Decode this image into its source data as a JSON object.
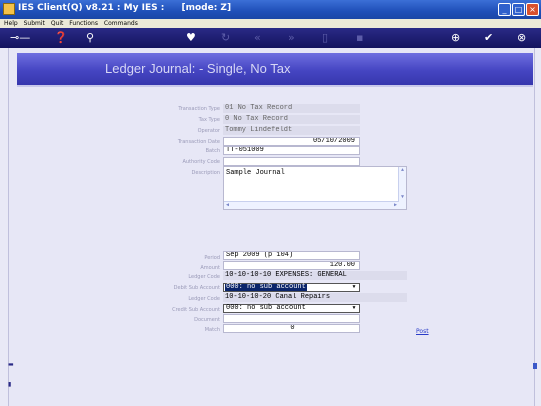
{
  "window": {
    "title": "IES Client(Q) v8.21 : My IES :",
    "mode": "[mode: Z]"
  },
  "menu": [
    "Help",
    "Submit",
    "Quit",
    "Functions",
    "Commands"
  ],
  "toolbar_icons": [
    "key-icon",
    "help-icon",
    "search-icon",
    "heart-icon",
    "refresh-icon",
    "back-icon",
    "forward-icon",
    "list-icon",
    "delete-icon",
    "add-icon",
    "check-icon",
    "close-icon"
  ],
  "banner": {
    "title": "Ledger Journal: -    Single, No Tax"
  },
  "form": {
    "transaction_type": {
      "label": "Transaction Type",
      "value": "01 No Tax Record"
    },
    "tax_type": {
      "label": "Tax Type",
      "value": "0 No Tax Record"
    },
    "operator": {
      "label": "Operator",
      "value": "Tommy Lindefeldt"
    },
    "transaction_date": {
      "label": "Transaction Date",
      "value": "05/10/2009"
    },
    "batch": {
      "label": "Batch",
      "value": "TT-051009"
    },
    "authority_code": {
      "label": "Authority Code",
      "value": ""
    },
    "description": {
      "label": "Description",
      "value": "Sample Journal"
    },
    "period": {
      "label": "Period",
      "value": "Sep 2009 (p 104)"
    },
    "amount": {
      "label": "Amount",
      "value": "120.00"
    },
    "debit_ledger_code": {
      "label": "Ledger Code",
      "value": "10-10-10-10 EXPENSES: GENERAL"
    },
    "debit_sub_account": {
      "label": "Debit Sub Account",
      "value": "000: no sub account"
    },
    "credit_ledger_code": {
      "label": "Ledger Code",
      "value": "10-10-10-20 Canal Repairs"
    },
    "credit_sub_account": {
      "label": "Credit Sub Account",
      "value": "000: no sub account"
    },
    "document": {
      "label": "Document",
      "value": ""
    },
    "match": {
      "label": "Match",
      "value": "0"
    }
  },
  "actions": {
    "post": "Post"
  },
  "colors": {
    "titlebar": "#1f4fb8",
    "toolbar": "#13135e",
    "banner": "#4545c2",
    "background": "#e9e9f6",
    "selection": "#0a246a",
    "link": "#2a3cc8"
  }
}
